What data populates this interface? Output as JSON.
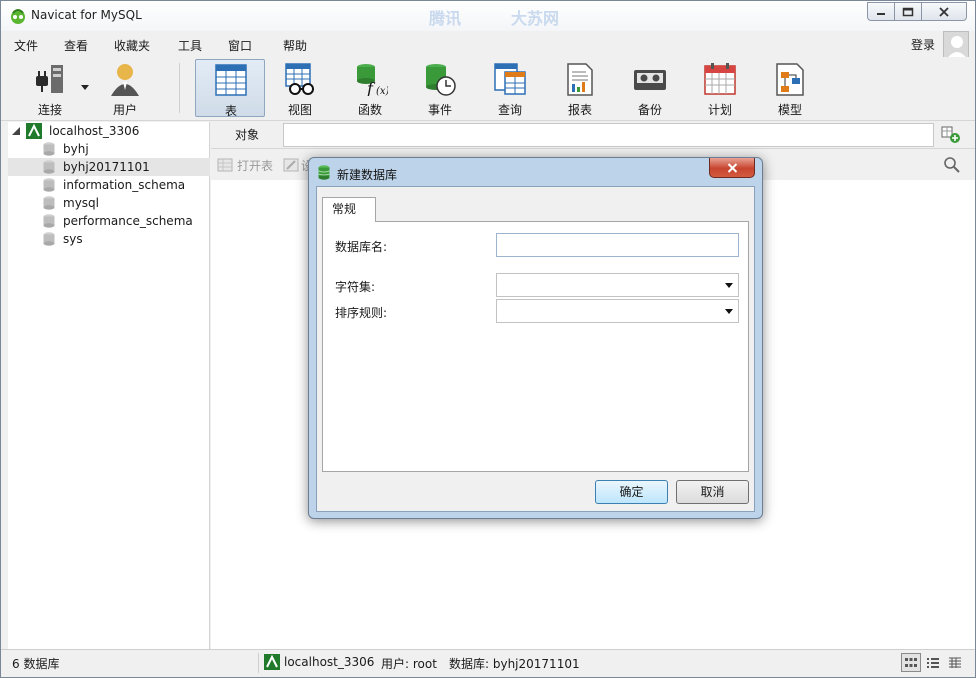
{
  "window": {
    "title": "Navicat for MySQL",
    "ghost_text": [
      "腾讯",
      "大苏网"
    ]
  },
  "menu": {
    "items": [
      "文件",
      "查看",
      "收藏夹",
      "工具",
      "窗口",
      "帮助"
    ],
    "login": "登录"
  },
  "toolbar": {
    "tools": [
      {
        "label": "连接",
        "icon": "plug-icon"
      },
      {
        "label": "用户",
        "icon": "user-icon"
      },
      {
        "label": "表",
        "icon": "table-icon",
        "active": true
      },
      {
        "label": "视图",
        "icon": "view-icon"
      },
      {
        "label": "函数",
        "icon": "function-icon"
      },
      {
        "label": "事件",
        "icon": "event-icon"
      },
      {
        "label": "查询",
        "icon": "query-icon"
      },
      {
        "label": "报表",
        "icon": "report-icon"
      },
      {
        "label": "备份",
        "icon": "backup-icon"
      },
      {
        "label": "计划",
        "icon": "schedule-icon"
      },
      {
        "label": "模型",
        "icon": "model-icon"
      }
    ]
  },
  "tree": {
    "connection": "localhost_3306",
    "databases": [
      "byhj",
      "byhj20171101",
      "information_schema",
      "mysql",
      "performance_schema",
      "sys"
    ],
    "selected": "byhj20171101"
  },
  "objects": {
    "tab_label": "对象",
    "toolbar": [
      "打开表",
      "设"
    ]
  },
  "status": {
    "db_count": "6 数据库",
    "connection": "localhost_3306",
    "user": "用户: root",
    "database": "数据库: byhj20171101"
  },
  "dialog": {
    "title": "新建数据库",
    "tab": "常规",
    "fields": {
      "name_label": "数据库名:",
      "name_value": "",
      "charset_label": "字符集:",
      "charset_value": "",
      "collation_label": "排序规则:",
      "collation_value": ""
    },
    "ok": "确定",
    "cancel": "取消"
  },
  "colors": {
    "accent": "#3c7fb1",
    "db_green": "#3a9a3a",
    "close_red": "#c7452f"
  }
}
